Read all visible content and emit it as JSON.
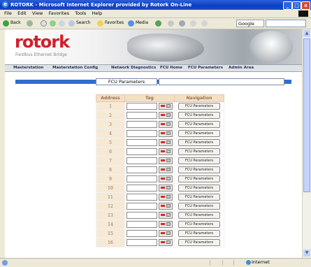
{
  "window": {
    "title": "ROTORK - Microsoft Internet Explorer provided by Rotork On-Line"
  },
  "menu": [
    "File",
    "Edit",
    "View",
    "Favorites",
    "Tools",
    "Help"
  ],
  "toolbar": {
    "back": "Back",
    "search": "Search",
    "favorites": "Favorites",
    "media": "Media",
    "google": "Google"
  },
  "site": {
    "logo": "rotork",
    "sublogo": "Fieldbus Ethernet Bridge"
  },
  "nav": [
    "Masterstation",
    "Masterstation Config",
    "Network Diagnostics",
    "FCU Home",
    "FCU Parameters",
    "Admin Area"
  ],
  "page": {
    "fcu_label": "FCU Parameters"
  },
  "table": {
    "headers": [
      "Address",
      "Tag",
      "Navigation"
    ],
    "rows": [
      "1",
      "2",
      "3",
      "4",
      "5",
      "6",
      "7",
      "8",
      "9",
      "10",
      "11",
      "12",
      "13",
      "14",
      "15",
      "16"
    ],
    "button_label": "FCU Parameters"
  },
  "status": {
    "zone": "Internet"
  },
  "colors": {
    "brand_red": "#d21f2c",
    "title_blue": "#0b3ec4",
    "bar_blue": "#2f6fd0"
  }
}
